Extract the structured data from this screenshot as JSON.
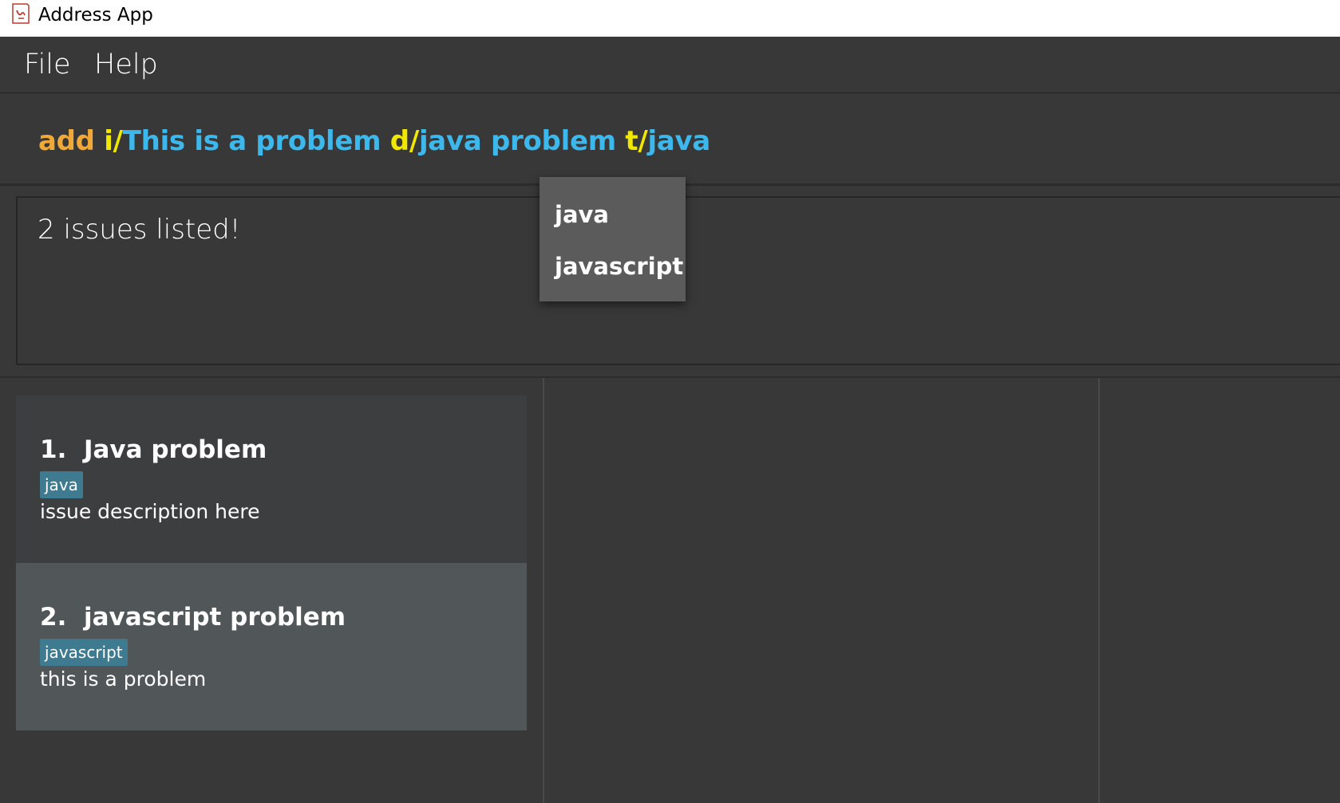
{
  "window": {
    "title": "Address App",
    "icon": "address-book-icon"
  },
  "menu": {
    "items": [
      "File",
      "Help"
    ]
  },
  "command": {
    "segments": [
      {
        "text": "add",
        "role": "command-word"
      },
      {
        "text": " ",
        "role": "space"
      },
      {
        "text": "i/",
        "role": "prefix"
      },
      {
        "text": "This is a problem",
        "role": "value"
      },
      {
        "text": " ",
        "role": "space"
      },
      {
        "text": "d/",
        "role": "prefix"
      },
      {
        "text": "java problem",
        "role": "value"
      },
      {
        "text": " ",
        "role": "space"
      },
      {
        "text": "t/",
        "role": "prefix"
      },
      {
        "text": "java",
        "role": "value"
      }
    ],
    "colors": {
      "command_word": "#f0a838",
      "prefix": "#f0e800",
      "value": "#3cb8ec"
    }
  },
  "autocomplete": {
    "options": [
      "java",
      "javascript"
    ]
  },
  "result": {
    "message": "2 issues listed!"
  },
  "issues": [
    {
      "index": "1.",
      "title": "Java problem",
      "tag": "java",
      "description": "issue description here"
    },
    {
      "index": "2.",
      "title": "javascript problem",
      "tag": "javascript",
      "description": "this is a problem"
    }
  ],
  "colors": {
    "background": "#383838",
    "tag": "#3e7b91",
    "selected_card": "#515658"
  }
}
